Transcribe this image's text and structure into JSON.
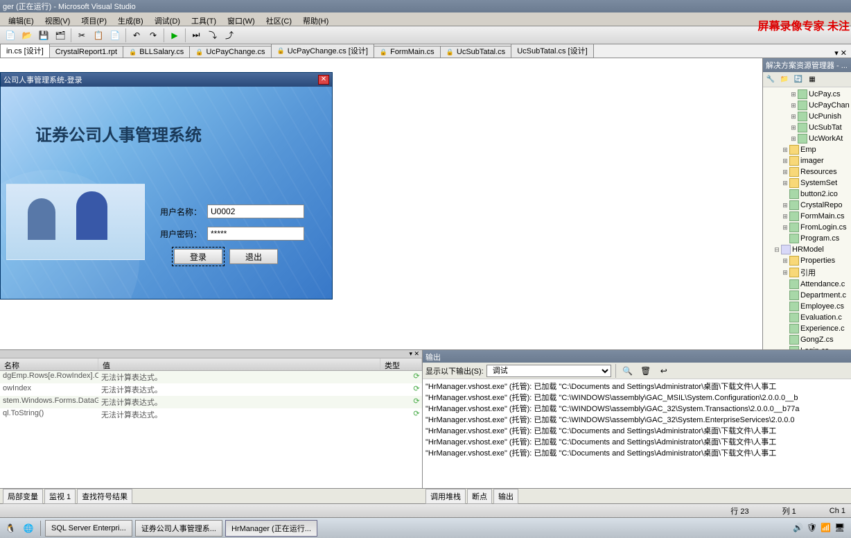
{
  "titlebar": "ger (正在运行) - Microsoft Visual Studio",
  "watermark": "屏幕录像专家 未注",
  "menu": [
    "编辑(E)",
    "视图(V)",
    "项目(P)",
    "生成(B)",
    "调试(D)",
    "工具(T)",
    "窗口(W)",
    "社区(C)",
    "帮助(H)"
  ],
  "doc_tabs": [
    {
      "label": "in.cs [设计]",
      "active": true,
      "lock": false
    },
    {
      "label": "CrystalReport1.rpt",
      "lock": false
    },
    {
      "label": "BLLSalary.cs",
      "lock": true
    },
    {
      "label": "UcPayChange.cs",
      "lock": true
    },
    {
      "label": "UcPayChange.cs [设计]",
      "lock": true
    },
    {
      "label": "FormMain.cs",
      "lock": true
    },
    {
      "label": "UcSubTatal.cs",
      "lock": true
    },
    {
      "label": "UcSubTatal.cs [设计]"
    }
  ],
  "login": {
    "window_title": "公司人事管理系统-登录",
    "heading": "证券公司人事管理系统",
    "user_label": "用户名称：",
    "user_value": "U0002",
    "pass_label": "用户密码：",
    "pass_value": "*****",
    "btn_login": "登录",
    "btn_exit": "退出"
  },
  "solution": {
    "title": "解决方案资源管理器 - ...",
    "items": [
      {
        "indent": 3,
        "exp": "+",
        "icon": "cs",
        "label": "UcPay.cs"
      },
      {
        "indent": 3,
        "exp": "+",
        "icon": "cs",
        "label": "UcPayChan"
      },
      {
        "indent": 3,
        "exp": "+",
        "icon": "cs",
        "label": "UcPunish"
      },
      {
        "indent": 3,
        "exp": "+",
        "icon": "cs",
        "label": "UcSubTat"
      },
      {
        "indent": 3,
        "exp": "+",
        "icon": "cs",
        "label": "UcWorkAt"
      },
      {
        "indent": 2,
        "exp": "+",
        "icon": "folder",
        "label": "Emp"
      },
      {
        "indent": 2,
        "exp": "+",
        "icon": "folder",
        "label": "imager"
      },
      {
        "indent": 2,
        "exp": "+",
        "icon": "folder",
        "label": "Resources"
      },
      {
        "indent": 2,
        "exp": "+",
        "icon": "folder",
        "label": "SystemSet"
      },
      {
        "indent": 2,
        "exp": "",
        "icon": "cs",
        "label": "button2.ico"
      },
      {
        "indent": 2,
        "exp": "+",
        "icon": "cs",
        "label": "CrystalRepo"
      },
      {
        "indent": 2,
        "exp": "+",
        "icon": "cs",
        "label": "FormMain.cs"
      },
      {
        "indent": 2,
        "exp": "+",
        "icon": "cs",
        "label": "FromLogin.cs"
      },
      {
        "indent": 2,
        "exp": "",
        "icon": "cs",
        "label": "Program.cs"
      },
      {
        "indent": 1,
        "exp": "-",
        "icon": "proj",
        "label": "HRModel"
      },
      {
        "indent": 2,
        "exp": "+",
        "icon": "folder",
        "label": "Properties"
      },
      {
        "indent": 2,
        "exp": "+",
        "icon": "folder",
        "label": "引用"
      },
      {
        "indent": 2,
        "exp": "",
        "icon": "cs",
        "label": "Attendance.c"
      },
      {
        "indent": 2,
        "exp": "",
        "icon": "cs",
        "label": "Department.c"
      },
      {
        "indent": 2,
        "exp": "",
        "icon": "cs",
        "label": "Employee.cs"
      },
      {
        "indent": 2,
        "exp": "",
        "icon": "cs",
        "label": "Evaluation.c"
      },
      {
        "indent": 2,
        "exp": "",
        "icon": "cs",
        "label": "Experience.c"
      },
      {
        "indent": 2,
        "exp": "",
        "icon": "cs",
        "label": "GongZ.cs"
      },
      {
        "indent": 2,
        "exp": "",
        "icon": "cs",
        "label": "Login.cs"
      }
    ]
  },
  "watch": {
    "col_name": "名称",
    "col_value": "值",
    "col_type": "类型",
    "rows": [
      {
        "name": "dgEmp.Rows[e.RowIndex].C",
        "value": "无法计算表达式。"
      },
      {
        "name": "owIndex",
        "value": "无法计算表达式。"
      },
      {
        "name": "stem.Windows.Forms.DataGr",
        "value": "无法计算表达式。"
      },
      {
        "name": "ql.ToString()",
        "value": "无法计算表达式。"
      }
    ]
  },
  "output": {
    "title": "输出",
    "show_label": "显示以下输出(S):",
    "combo": "调试",
    "lines": [
      "\"HrManager.vshost.exe\" (托管): 已加载 \"C:\\Documents and Settings\\Administrator\\桌面\\下载文件\\人事工",
      "\"HrManager.vshost.exe\" (托管): 已加载 \"C:\\WINDOWS\\assembly\\GAC_MSIL\\System.Configuration\\2.0.0.0__b",
      "\"HrManager.vshost.exe\" (托管): 已加载 \"C:\\WINDOWS\\assembly\\GAC_32\\System.Transactions\\2.0.0.0__b77a",
      "\"HrManager.vshost.exe\" (托管): 已加载 \"C:\\WINDOWS\\assembly\\GAC_32\\System.EnterpriseServices\\2.0.0.0",
      "\"HrManager.vshost.exe\" (托管): 已加载 \"C:\\Documents and Settings\\Administrator\\桌面\\下载文件\\人事工",
      "\"HrManager.vshost.exe\" (托管): 已加载 \"C:\\Documents and Settings\\Administrator\\桌面\\下载文件\\人事工",
      "\"HrManager.vshost.exe\" (托管): 已加载 \"C:\\Documents and Settings\\Administrator\\桌面\\下载文件\\人事工"
    ]
  },
  "bottom_tabs_left": [
    "局部变量",
    "监视 1",
    "查找符号结果"
  ],
  "bottom_tabs_right": [
    "调用堆栈",
    "断点",
    "输出"
  ],
  "status": {
    "line": "行 23",
    "col": "列 1",
    "ch": "Ch 1"
  },
  "taskbar": [
    {
      "label": "SQL Server Enterpri..."
    },
    {
      "label": "证券公司人事管理系..."
    },
    {
      "label": "HrManager (正在运行...",
      "active": true
    }
  ]
}
